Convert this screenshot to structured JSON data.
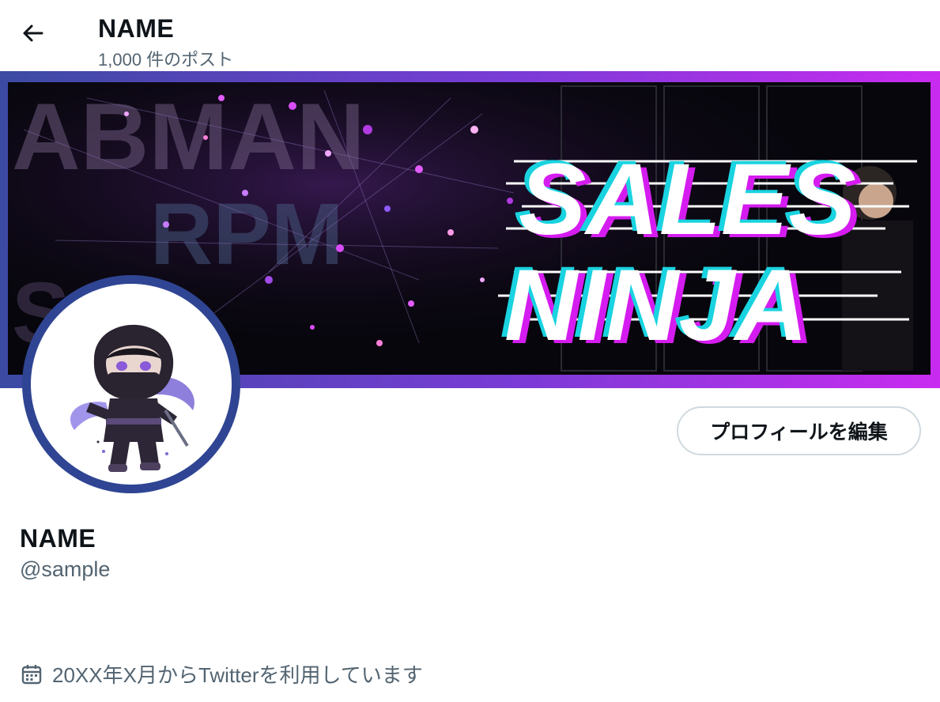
{
  "header": {
    "title": "NAME",
    "post_count": "1,000 件のポスト"
  },
  "banner": {
    "line1": "SALES",
    "line2": "NINJA",
    "bg_letters": [
      "ABMAN",
      "RPM",
      "SAL"
    ],
    "gradient_colors": [
      "#3b4aa3",
      "#c92bf0"
    ],
    "accent_colors": {
      "magenta": "#d51cf0",
      "cyan": "#19d3e0"
    }
  },
  "profile": {
    "name": "NAME",
    "handle": "@sample",
    "edit_button": "プロフィールを編集",
    "joined": "20XX年X月からTwitterを利用しています",
    "avatar_icon": "ninja-avatar",
    "avatar_ring_color": "#2f4593"
  }
}
